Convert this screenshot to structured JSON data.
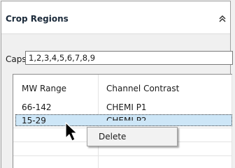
{
  "panel": {
    "title": "Crop Regions",
    "collapse_icon": "chevron-double-up-icon"
  },
  "caps": {
    "label": "Caps",
    "value": "1,2,3,4,5,6,7,8,9"
  },
  "table": {
    "columns": [
      "MW Range",
      "Channel Contrast"
    ],
    "rows": [
      {
        "mw_range": "66-142",
        "channel_contrast": "CHEMI P1"
      },
      {
        "mw_range": "15-29",
        "channel_contrast": "CHEMI P2"
      }
    ],
    "selected_row": 2
  },
  "context_menu": {
    "items": [
      {
        "label": "Delete"
      }
    ]
  },
  "colors": {
    "selection": "#cde6f7",
    "title_text": "#1b2a3a"
  }
}
